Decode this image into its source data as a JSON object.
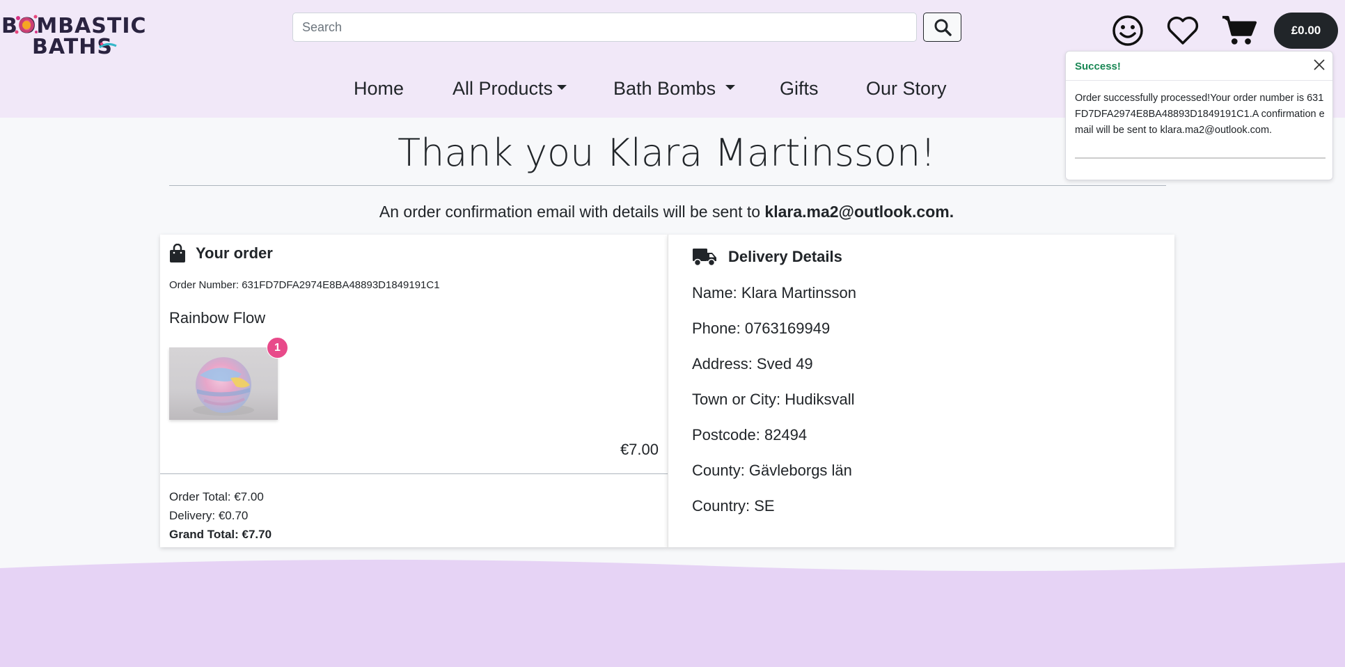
{
  "header": {
    "logo_text_line1": "BOMBASTIC",
    "logo_text_line2": "BATHS",
    "search": {
      "placeholder": "Search"
    },
    "cart_total": "£0.00"
  },
  "nav": [
    {
      "label": "Home"
    },
    {
      "label": "All Products"
    },
    {
      "label": "Bath Bombs"
    },
    {
      "label": "Gifts"
    },
    {
      "label": "Our Story"
    }
  ],
  "toast": {
    "title": "Success!",
    "message": "Order successfully processed!Your order number is 631FD7DFA2974E8BA48893D1849191C1.A confirmation email will be sent to klara.ma2@outlook.com."
  },
  "page": {
    "title": "Thank you Klara Martinsson!",
    "confirm_prefix": "An order confirmation email with details will be sent to",
    "confirm_email": "klara.ma2@outlook.com."
  },
  "order": {
    "heading": "Your order",
    "order_number": "Order Number: 631FD7DFA2974E8BA48893D1849191C1",
    "product_name": "Rainbow Flow",
    "quantity": "1",
    "line_price": "€7.00",
    "order_total": "Order Total: €7.00",
    "delivery": "Delivery: €0.70",
    "grand_total": "Grand Total: €7.70"
  },
  "delivery": {
    "heading": "Delivery Details",
    "rows": [
      "Name: Klara Martinsson",
      "Phone: 0763169949",
      "Address: Sved 49",
      "Town or City: Hudiksvall",
      "Postcode: 82494",
      "County: Gävleborgs län",
      "Country: SE"
    ]
  },
  "colors": {
    "header_bg": "#f1e8f8",
    "footer_bg": "#e6d3f5",
    "badge": "#e84a8a",
    "success": "#198754"
  }
}
